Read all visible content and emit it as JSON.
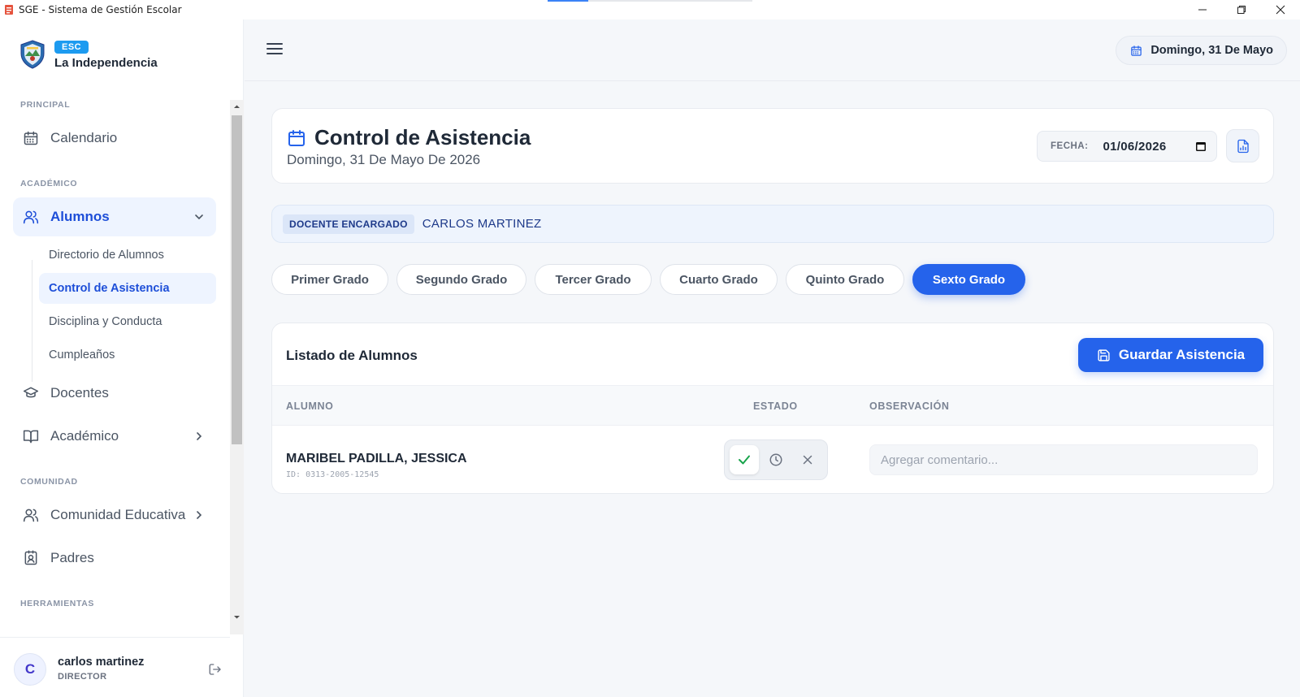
{
  "window": {
    "title": "SGE - Sistema de Gestión Escolar",
    "controls": [
      "minimize-icon",
      "restore-icon",
      "close-icon"
    ]
  },
  "brand": {
    "badge": "ESC",
    "school": "La Independencia"
  },
  "sidebar": {
    "sections": {
      "principal": "PRINCIPAL",
      "academico": "ACADÉMICO",
      "comunidad": "COMUNIDAD",
      "herramientas": "HERRAMIENTAS"
    },
    "items": [
      {
        "label": "Calendario",
        "icon": "calendar-icon"
      },
      {
        "label": "Alumnos",
        "icon": "users-icon",
        "active": true,
        "expanded": true
      },
      {
        "label": "Docentes",
        "icon": "graduation-cap-icon"
      },
      {
        "label": "Académico",
        "icon": "book-open-icon"
      },
      {
        "label": "Comunidad Educativa",
        "icon": "users-icon"
      },
      {
        "label": "Padres",
        "icon": "contact-icon"
      }
    ],
    "alumnos_sub": [
      {
        "label": "Directorio de Alumnos"
      },
      {
        "label": "Control de Asistencia",
        "active": true
      },
      {
        "label": "Disciplina y Conducta"
      },
      {
        "label": "Cumpleaños"
      }
    ]
  },
  "user": {
    "initial": "C",
    "name": "carlos martinez",
    "role": "DIRECTOR"
  },
  "topbar": {
    "date": "Domingo, 31 De Mayo"
  },
  "page": {
    "title": "Control de Asistencia",
    "subtitle": "Domingo, 31 De Mayo De 2026",
    "fecha_label": "FECHA:",
    "fecha_value": "01/06/2026"
  },
  "docente": {
    "label": "DOCENTE ENCARGADO",
    "name": "CARLOS MARTINEZ"
  },
  "grades": [
    {
      "label": "Primer Grado"
    },
    {
      "label": "Segundo Grado"
    },
    {
      "label": "Tercer Grado"
    },
    {
      "label": "Cuarto Grado"
    },
    {
      "label": "Quinto Grado"
    },
    {
      "label": "Sexto Grado",
      "active": true
    }
  ],
  "list": {
    "title": "Listado de Alumnos",
    "save_label": "Guardar Asistencia",
    "columns": [
      "ALUMNO",
      "ESTADO",
      "OBSERVACIÓN"
    ],
    "rows": [
      {
        "name": "MARIBEL PADILLA, JESSICA",
        "id": "ID: 0313-2005-12545",
        "status": "presente",
        "comment_placeholder": "Agregar comentario..."
      }
    ]
  },
  "colors": {
    "accent": "#2563eb",
    "active_text": "#1d4ed8",
    "present": "#16a34a",
    "badge": "#1d9bf0"
  }
}
